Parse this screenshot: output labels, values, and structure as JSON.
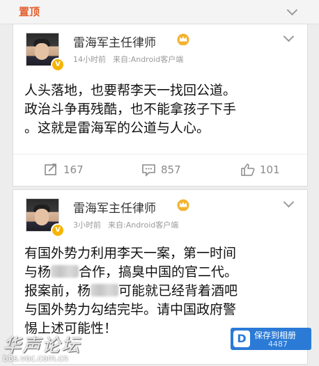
{
  "pin_bar": {
    "label": "置顶"
  },
  "posts": [
    {
      "author": "雷海军主任律师",
      "time": "14小时前",
      "source": "来自:Android客户端",
      "verified_mark": "V",
      "text_lines": [
        "人头落地，也要帮李天一找回公道。",
        "政治斗争再残酷，也不能拿孩子下手",
        "。这就是雷海军的公道与人心。"
      ],
      "actions": {
        "repost": "167",
        "comment": "857",
        "like": "101"
      }
    },
    {
      "author": "雷海军主任律师",
      "time": "3小时前",
      "source": "来自:Android客户端",
      "verified_mark": "V",
      "text": {
        "line1": "有国外势力利用李天一案，第一时间",
        "line2_pre": "与杨",
        "line2_post": "合作，搞臭中国的官二代。",
        "line3_pre": "报案前，杨",
        "line3_post": "可能就已经背着酒吧",
        "line4": "与国外势力勾结完毕。请中国政府警",
        "line5": "惕上述可能性！"
      }
    }
  ],
  "watermark": {
    "site_text": "华声论坛",
    "url": "bbs.voc.com.cn"
  },
  "save_badge": {
    "icon_letter": "D",
    "title": "保存到相册",
    "number": "4487"
  },
  "colors": {
    "pin_label": "#e35d2d",
    "badge_bg": "#2b7bd6",
    "verified": "#f5b400"
  }
}
